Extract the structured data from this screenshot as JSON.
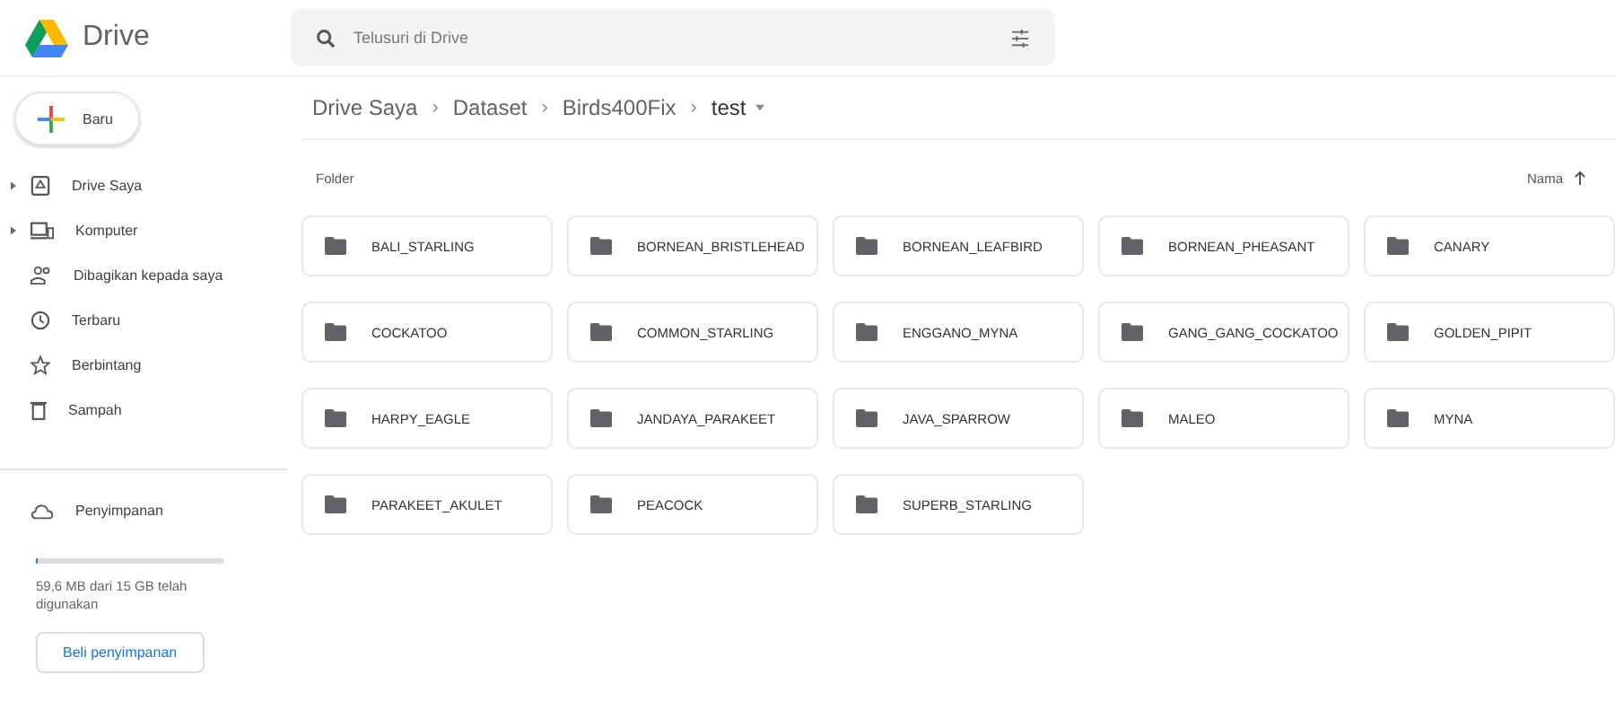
{
  "app": {
    "name": "Drive"
  },
  "search": {
    "placeholder": "Telusuri di Drive"
  },
  "new_button": {
    "label": "Baru"
  },
  "sidebar": {
    "items": [
      {
        "label": "Drive Saya",
        "expandable": true
      },
      {
        "label": "Komputer",
        "expandable": true
      },
      {
        "label": "Dibagikan kepada saya",
        "expandable": false
      },
      {
        "label": "Terbaru",
        "expandable": false
      },
      {
        "label": "Berbintang",
        "expandable": false
      },
      {
        "label": "Sampah",
        "expandable": false
      }
    ],
    "storage": {
      "label": "Penyimpanan",
      "level": 0.01,
      "usage": "59,6 MB dari 15 GB telah digunakan",
      "buy_button": "Beli penyimpanan"
    }
  },
  "breadcrumb": [
    {
      "label": "Drive Saya",
      "menu": false
    },
    {
      "separator": "›",
      "label": "Dataset",
      "menu": false
    },
    {
      "separator": "›",
      "label": "Birds400Fix",
      "menu": false
    },
    {
      "separator": "›",
      "label": "test",
      "menu": true
    }
  ],
  "section": {
    "label": "Folder",
    "sort": "Nama"
  },
  "folders": [
    {
      "name": "BALI_STARLING"
    },
    {
      "name": "BORNEAN_BRISTLEHEAD"
    },
    {
      "name": "BORNEAN_LEAFBIRD"
    },
    {
      "name": "BORNEAN_PHEASANT"
    },
    {
      "name": "CANARY"
    },
    {
      "name": "COCKATOO"
    },
    {
      "name": "COMMON_STARLING"
    },
    {
      "name": "ENGGANO_MYNA"
    },
    {
      "name": "GANG_GANG_COCKATOO"
    },
    {
      "name": "GOLDEN_PIPIT"
    },
    {
      "name": "HARPY_EAGLE"
    },
    {
      "name": "JANDAYA_PARAKEET"
    },
    {
      "name": "JAVA_SPARROW"
    },
    {
      "name": "MALEO"
    },
    {
      "name": "MYNA"
    },
    {
      "name": "PARAKEET_AKULET"
    },
    {
      "name": "PEACOCK"
    },
    {
      "name": "SUPERB_STARLING"
    }
  ]
}
